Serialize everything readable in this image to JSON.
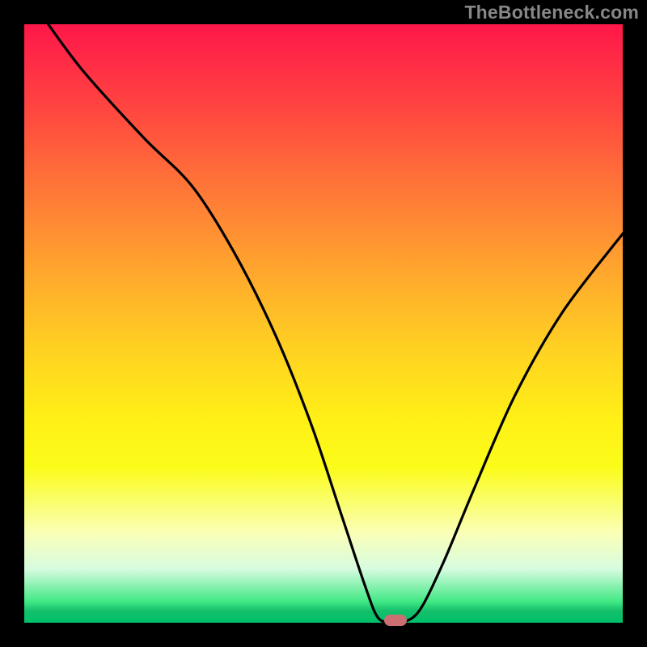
{
  "watermark": "TheBottleneck.com",
  "chart_data": {
    "type": "line",
    "title": "",
    "xlabel": "",
    "ylabel": "",
    "xlim": [
      0,
      100
    ],
    "ylim": [
      0,
      100
    ],
    "background": "red-yellow-green vertical gradient",
    "series": [
      {
        "name": "bottleneck-curve",
        "x": [
          4,
          10,
          20,
          28,
          35,
          42,
          48,
          53,
          57,
          59,
          61,
          63,
          66,
          70,
          75,
          82,
          90,
          100
        ],
        "y": [
          100,
          92,
          81,
          73,
          62,
          48,
          33,
          18,
          6,
          1,
          0,
          0,
          2,
          10,
          22,
          38,
          52,
          65
        ]
      }
    ],
    "marker": {
      "x_percent": 62,
      "color": "#cc6f72",
      "shape": "pill"
    },
    "gradient_stops": [
      {
        "pct": 0,
        "color": "#ff1749"
      },
      {
        "pct": 24,
        "color": "#ff6a3a"
      },
      {
        "pct": 55,
        "color": "#ffd321"
      },
      {
        "pct": 85,
        "color": "#faffb7"
      },
      {
        "pct": 100,
        "color": "#00c06a"
      }
    ]
  }
}
